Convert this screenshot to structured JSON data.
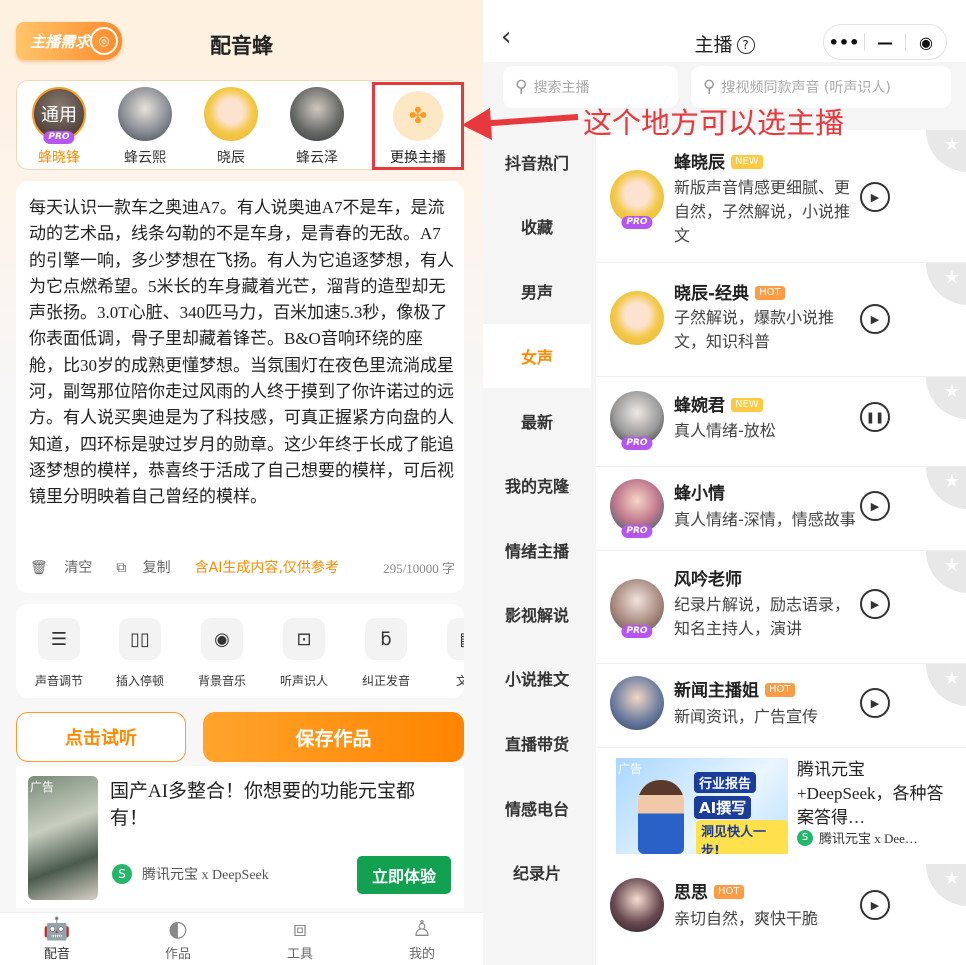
{
  "left": {
    "badge": "主播需求",
    "title": "配音蜂",
    "anchors": [
      {
        "name": "蜂晓锋",
        "avatar_text": "通用",
        "pro": "PRO",
        "selected": true
      },
      {
        "name": "蜂云熙"
      },
      {
        "name": "晓辰"
      },
      {
        "name": "蜂云泽"
      }
    ],
    "change_label": "更换主播",
    "callout": "这个地方可以选主播",
    "script_text": "每天认识一款车之奥迪A7。有人说奥迪A7不是车，是流动的艺术品，线条勾勒的不是车身，是青春的无敌。A7的引擎一响，多少梦想在飞扬。有人为它追逐梦想，有人为它点燃希望。5米长的车身藏着光芒，溜背的造型却无声张扬。3.0T心脏、340匹马力，百米加速5.3秒，像极了你表面低调，骨子里却藏着锋芒。B&O音响环绕的座舱，比30岁的成熟更懂梦想。当氛围灯在夜色里流淌成星河，副驾那位陪你走过风雨的人终于摸到了你许诺过的远方。有人说买奥迪是为了科技感，可真正握紧方向盘的人知道，四环标是驶过岁月的勋章。这少年终于长成了能追逐梦想的模样，恭喜终于活成了自己想要的模样，可后视镜里分明映着自己曾经的模样。",
    "clear": "清空",
    "copy": "复制",
    "ai_notice": "含AI生成内容,仅供参考",
    "char_count": "295/10000 字",
    "effects": [
      "声音调节",
      "插入停顿",
      "背景音乐",
      "听声识人",
      "纠正发音",
      "文案"
    ],
    "try_button": "点击试听",
    "save_button": "保存作品",
    "ad": {
      "tag": "广告",
      "headline": "国产AI多整合！你想要的功能元宝都有！",
      "source": "腾讯元宝 x DeepSeek",
      "cta": "立即体验"
    },
    "tabs": [
      "配音",
      "作品",
      "工具",
      "我的"
    ]
  },
  "right": {
    "title": "主播",
    "search_placeholder": "搜索主播",
    "voice_search_placeholder": "搜视频同款声音 (听声识人)",
    "categories": [
      "抖音热门",
      "收藏",
      "男声",
      "女声",
      "最新",
      "我的克隆",
      "情绪主播",
      "影视解说",
      "小说推文",
      "直播带货",
      "情感电台",
      "纪录片"
    ],
    "active_category": "女声",
    "voices": [
      {
        "name": "蜂晓辰",
        "tag": "NEW",
        "desc": "新版声音情感更细腻、更自然，子然解说，小说推文",
        "pro": "PRO",
        "state": "play"
      },
      {
        "name": "晓辰-经典",
        "tag": "HOT",
        "desc": "子然解说，爆款小说推文，知识科普",
        "state": "play"
      },
      {
        "name": "蜂婉君",
        "tag": "NEW",
        "desc": "真人情绪-放松",
        "pro": "PRO",
        "state": "pause"
      },
      {
        "name": "蜂小情",
        "desc": "真人情绪-深情，情感故事",
        "pro": "PRO",
        "state": "play"
      },
      {
        "name": "风吟老师",
        "desc": "纪录片解说，励志语录，知名主持人，演讲",
        "pro": "PRO",
        "state": "play"
      },
      {
        "name": "新闻主播姐",
        "tag": "HOT",
        "desc": "新闻资讯，广告宣传",
        "state": "play"
      },
      {
        "name": "思思",
        "tag": "HOT",
        "desc": "亲切自然，爽快干脆",
        "state": "play"
      }
    ],
    "ad": {
      "tag": "广告",
      "headline": "腾讯元宝+DeepSeek，各种答案答得…",
      "source": "腾讯元宝 x Dee…",
      "banner_line1": "行业报告",
      "banner_line2": "AI撰写",
      "banner_line3": "洞见快人一步!"
    }
  },
  "colors": {
    "accent": "#ff8a00",
    "highlight_box": "#e7383b",
    "pro": "#b656f0",
    "cta_green": "#12a150"
  }
}
